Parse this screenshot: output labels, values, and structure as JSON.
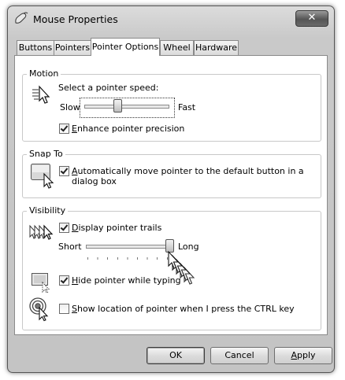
{
  "window": {
    "title": "Mouse Properties",
    "close_glyph": "✕"
  },
  "tabs": [
    {
      "label": "Buttons"
    },
    {
      "label": "Pointers"
    },
    {
      "label": "Pointer Options",
      "active": true
    },
    {
      "label": "Wheel"
    },
    {
      "label": "Hardware"
    }
  ],
  "motion": {
    "heading": "Motion",
    "speed_label": "Select a pointer speed:",
    "slow_label": "Slow",
    "fast_label": "Fast",
    "speed_value": 0.4,
    "precision_label": "Enhance pointer precision",
    "precision_checked": true
  },
  "snap": {
    "heading": "Snap To",
    "label_line1": "Automatically move pointer to the default button in a",
    "label_line2": "dialog box",
    "checked": true
  },
  "visibility": {
    "heading": "Visibility",
    "trails_label": "Display pointer trails",
    "trails_checked": true,
    "short_label": "Short",
    "long_label": "Long",
    "trail_length_value": 1.0,
    "hide_label": "Hide pointer while typing",
    "hide_checked": true,
    "ctrl_label": "Show location of pointer when I press the CTRL key",
    "ctrl_checked": false
  },
  "buttons": {
    "ok": "OK",
    "cancel": "Cancel",
    "apply": "Apply"
  },
  "icons": [
    "mouse-properties-icon",
    "close-icon",
    "pointer-speed-icon",
    "snap-to-icon",
    "pointer-trails-icon",
    "hide-pointer-icon",
    "show-location-icon",
    "trail-cursor-icon"
  ]
}
